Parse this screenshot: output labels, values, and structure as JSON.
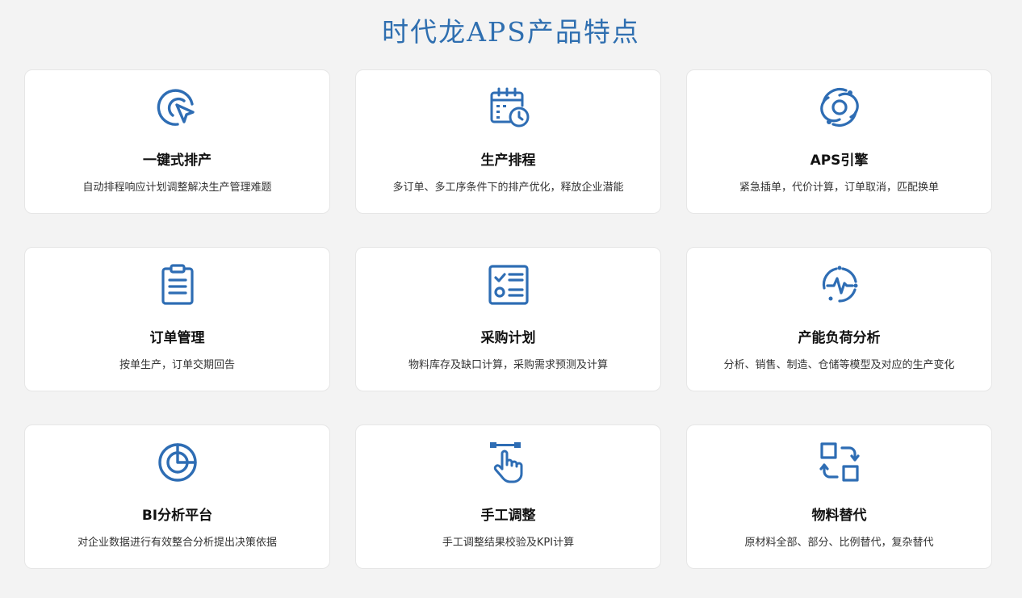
{
  "page": {
    "title": "时代龙APS产品特点",
    "title_color": "#2f6fb0",
    "icon_color": "#2e6db4"
  },
  "features": [
    {
      "icon": "cursor-target-icon",
      "title": "一键式排产",
      "desc": "自动排程响应计划调整解决生产管理难题"
    },
    {
      "icon": "calendar-clock-icon",
      "title": "生产排程",
      "desc": "多订单、多工序条件下的排产优化，释放企业潜能"
    },
    {
      "icon": "orbit-engine-icon",
      "title": "APS引擎",
      "desc": "紧急插单，代价计算，订单取消，匹配换单"
    },
    {
      "icon": "clipboard-list-icon",
      "title": "订单管理",
      "desc": "按单生产，订单交期回告"
    },
    {
      "icon": "checklist-icon",
      "title": "采购计划",
      "desc": "物料库存及缺口计算，采购需求预测及计算"
    },
    {
      "icon": "pulse-circle-icon",
      "title": "产能负荷分析",
      "desc": "分析、销售、制造、仓储等模型及对应的生产变化"
    },
    {
      "icon": "pie-chart-icon",
      "title": "BI分析平台",
      "desc": "对企业数据进行有效整合分析提出决策依据"
    },
    {
      "icon": "hand-adjust-icon",
      "title": "手工调整",
      "desc": "手工调整结果校验及KPI计算"
    },
    {
      "icon": "swap-squares-icon",
      "title": "物料替代",
      "desc": "原材料全部、部分、比例替代，复杂替代"
    }
  ]
}
